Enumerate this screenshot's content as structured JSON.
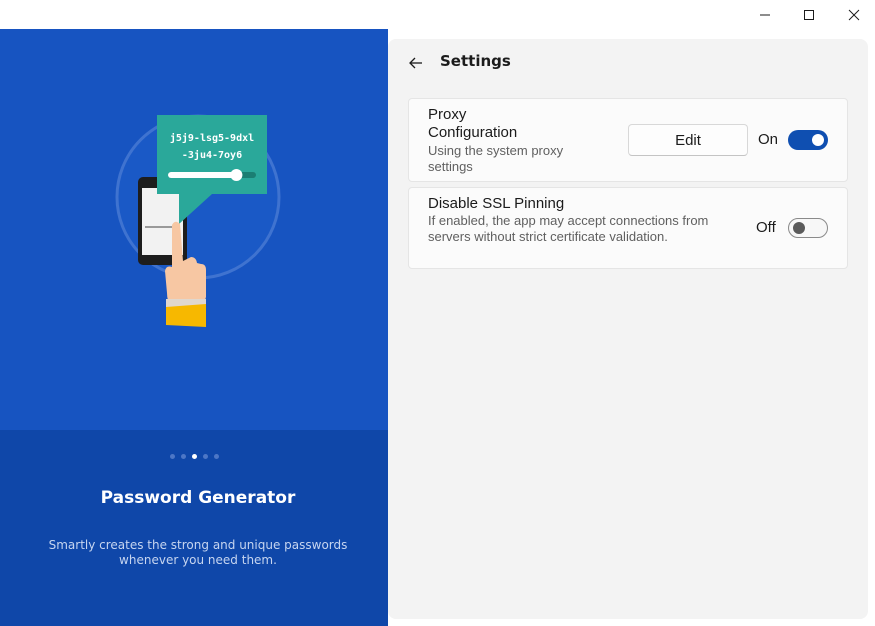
{
  "window": {
    "controls": {
      "minimize_icon": "minimize-icon",
      "maximize_icon": "maximize-icon",
      "close_icon": "close-icon"
    }
  },
  "promo": {
    "password_sample_line1": "j5j9-lsg5-9dxl",
    "password_sample_line2": "-3ju4-7oy6",
    "length_slider_level": 0.8,
    "pager": {
      "count": 5,
      "active_index": 2
    },
    "title": "Password Generator",
    "description": "Smartly creates the strong and unique passwords whenever you need them."
  },
  "settings": {
    "back_icon": "arrow-left-icon",
    "title": "Settings",
    "proxy": {
      "title": "Proxy Configuration",
      "description": "Using the system proxy settings",
      "edit_label": "Edit",
      "toggle_label": "On",
      "enabled": true
    },
    "ssl": {
      "title": "Disable SSL Pinning",
      "description": "If enabled, the app may accept connections from servers without strict certificate validation.",
      "toggle_label": "Off",
      "enabled": false
    }
  },
  "colors": {
    "accent": "#0f4fb1",
    "promo_background": "#1754c1",
    "promo_lower_background": "#0f47a9",
    "bubble": "#2aa89a",
    "sleeve": "#f7b800"
  }
}
